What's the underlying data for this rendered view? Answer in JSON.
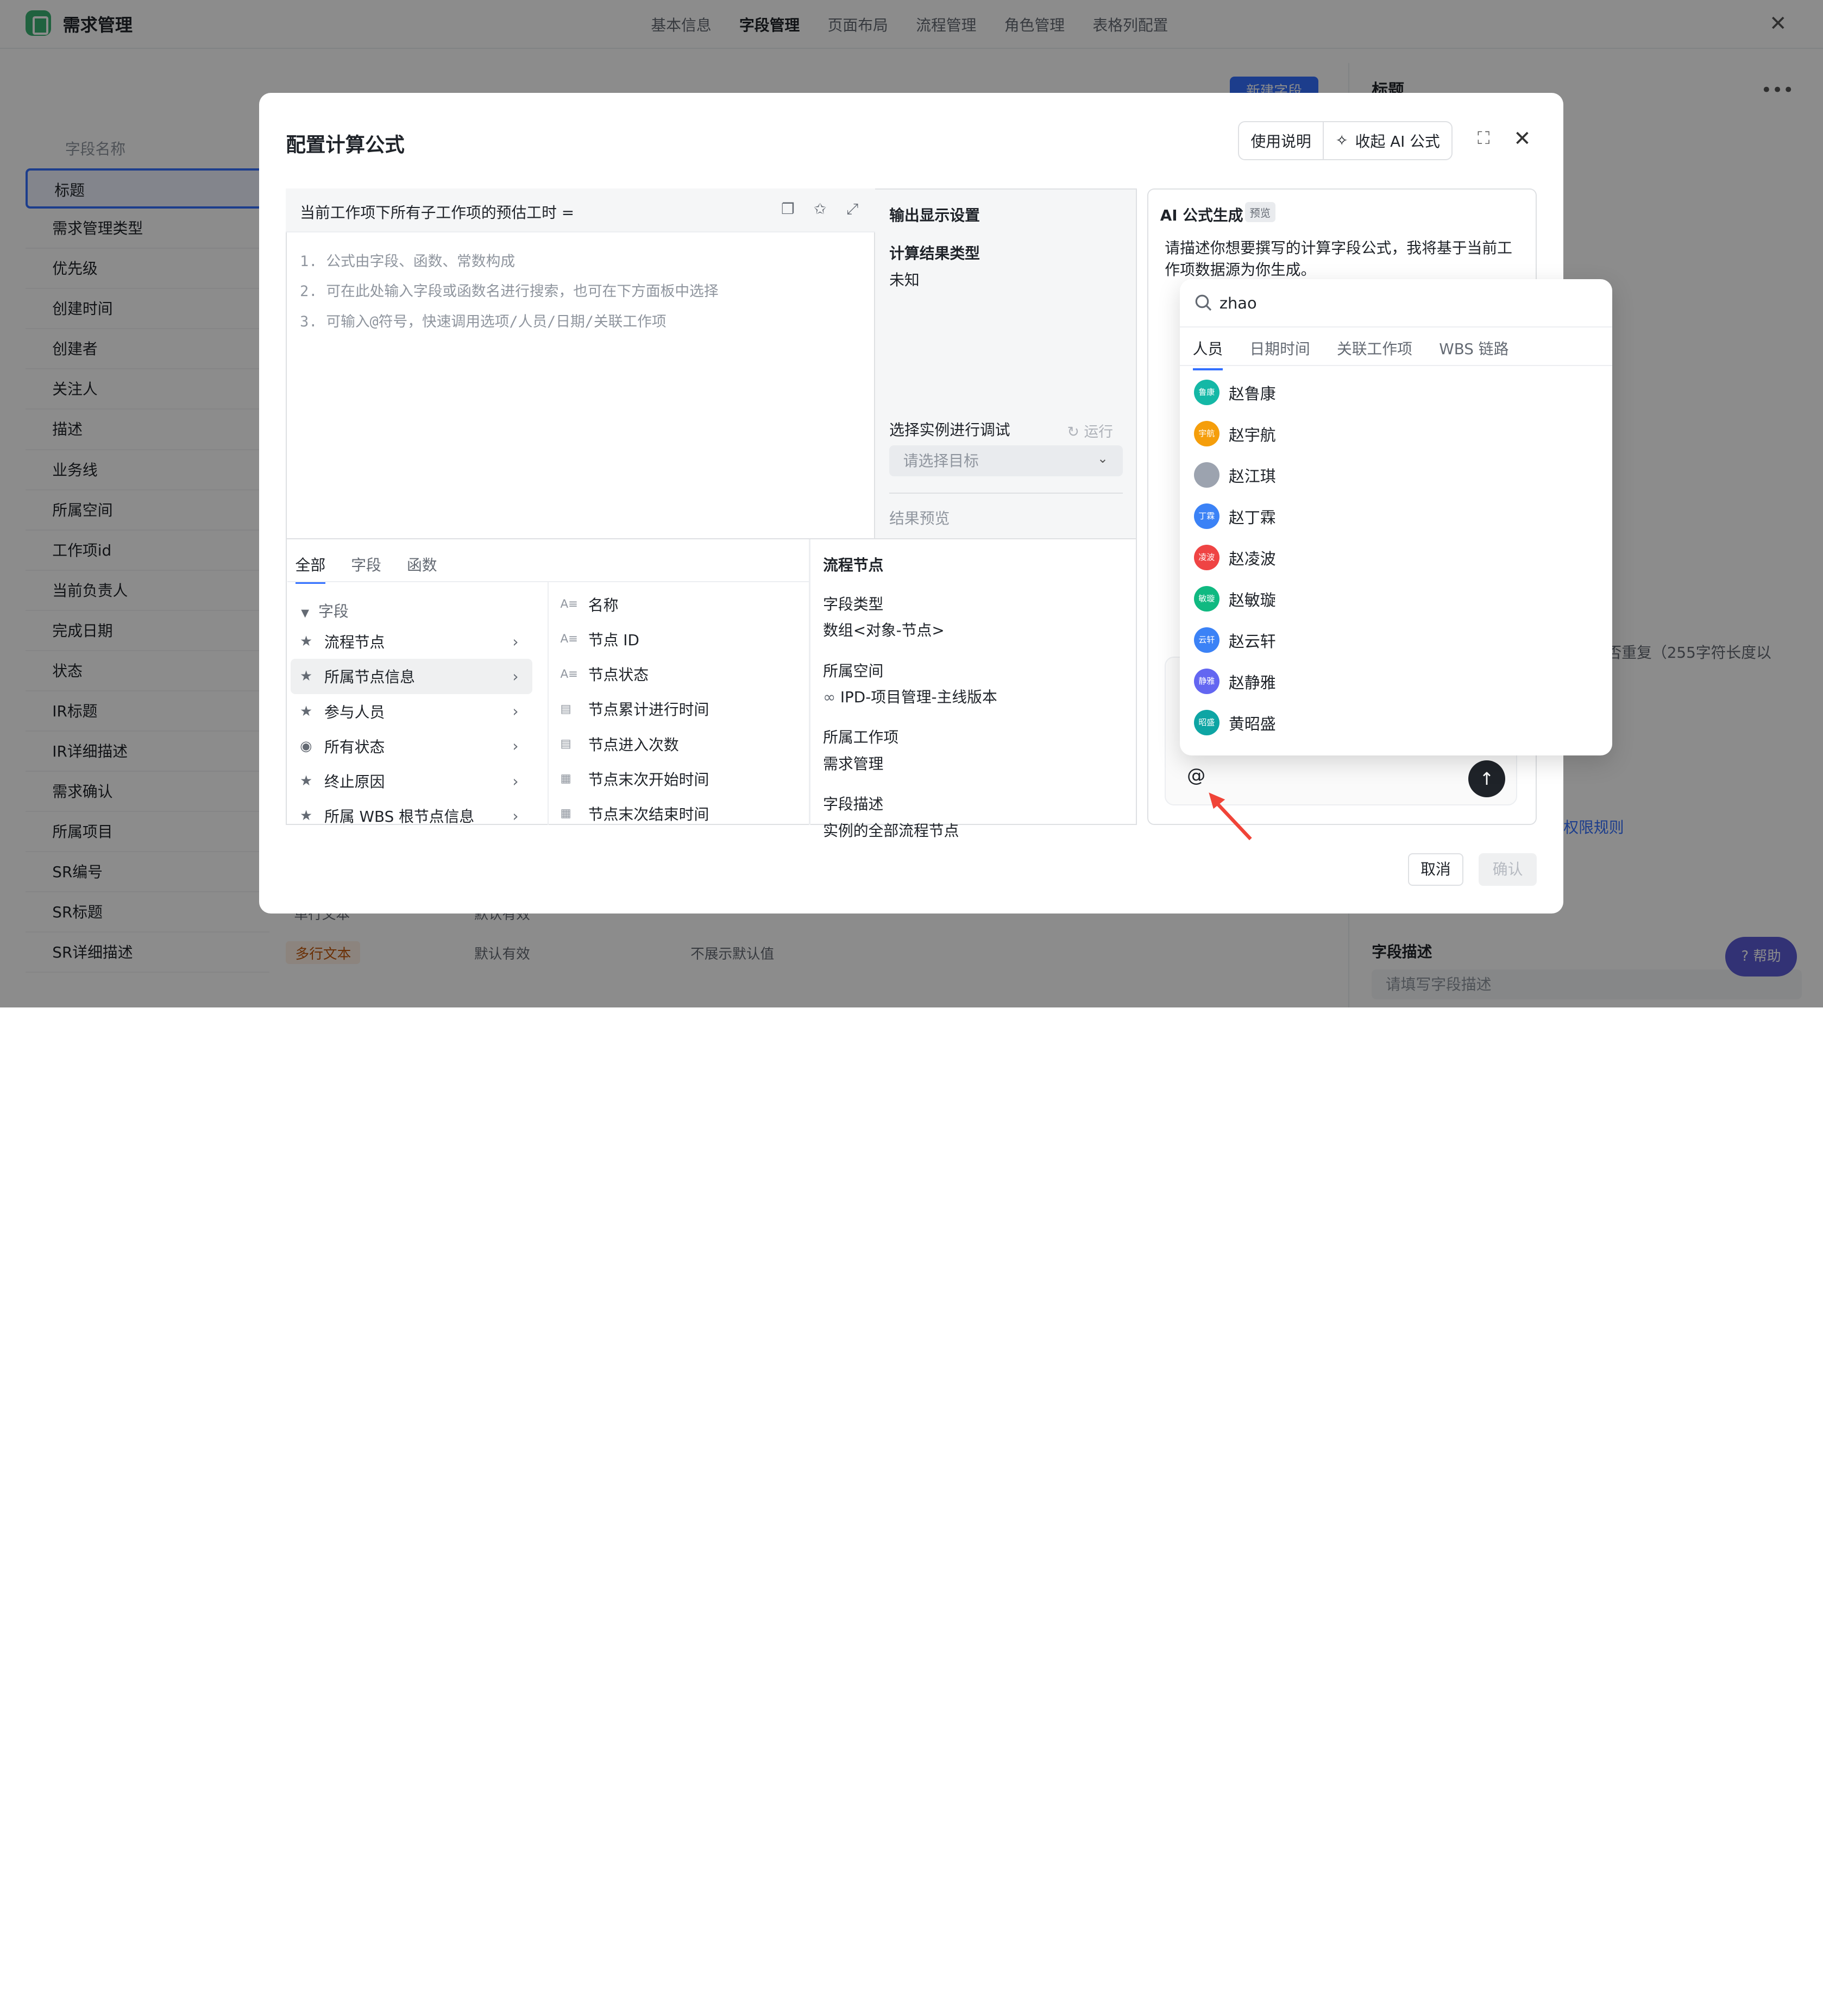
{
  "app": {
    "title": "需求管理",
    "nav": [
      "基本信息",
      "字段管理",
      "页面布局",
      "流程管理",
      "角色管理",
      "表格列配置"
    ],
    "active_nav": "字段管理",
    "close_icon": "close-icon"
  },
  "field_list": {
    "column_title": "字段名称",
    "items": [
      "标题",
      "需求管理类型",
      "优先级",
      "创建时间",
      "创建者",
      "关注人",
      "描述",
      "业务线",
      "所属空间",
      "工作项id",
      "当前负责人",
      "完成日期",
      "状态",
      "IR标题",
      "IR详细描述",
      "需求确认",
      "所属项目",
      "SR编号",
      "SR标题",
      "SR详细描述"
    ],
    "selected": "标题",
    "row_sr_title": {
      "type": "单行文本",
      "status": "默认有效"
    },
    "row_sr_desc": {
      "type": "多行文本",
      "status": "默认有效",
      "default": "不展示默认值"
    }
  },
  "background": {
    "new_field_button": "新建字段",
    "right_title": "标题",
    "right_hint": "否重复（255字符长度以",
    "right_link": "权限规则",
    "desc_label": "字段描述",
    "desc_placeholder": "请填写字段描述",
    "help_label": "帮助"
  },
  "modal": {
    "title": "配置计算公式",
    "usage_button": "使用说明",
    "collapse_ai_button": "收起 AI 公式",
    "cancel_button": "取消",
    "confirm_button": "确认",
    "editor": {
      "header": "当前工作项下所有子工作项的预估工时 =",
      "lines": [
        "1. 公式由字段、函数、常数构成",
        "2. 可在此处输入字段或函数名进行搜索，也可在下方面板中选择",
        "3. 可输入@符号，快速调用选项/人员/日期/关联工作项"
      ]
    },
    "output": {
      "title": "输出显示设置",
      "result_type_label": "计算结果类型",
      "result_type_value": "未知",
      "debug_label": "选择实例进行调试",
      "run_label": "运行",
      "target_placeholder": "请选择目标",
      "preview_label": "结果预览"
    },
    "palette": {
      "tabs": [
        "全部",
        "字段",
        "函数"
      ],
      "active_tab": "全部",
      "group_label": "字段",
      "categories": [
        "流程节点",
        "所属节点信息",
        "参与人员",
        "所有状态",
        "终止原因",
        "所属 WBS 根节点信息"
      ],
      "selected_category": "所属节点信息",
      "sub_items": [
        "名称",
        "节点 ID",
        "节点状态",
        "节点累计进行时间",
        "节点进入次数",
        "节点末次开始时间",
        "节点末次结束时间"
      ]
    },
    "detail": {
      "title": "流程节点",
      "type_label": "字段类型",
      "type_value": "数组<对象-节点>",
      "space_label": "所属空间",
      "space_value": "IPD-项目管理-主线版本",
      "item_label": "所属工作项",
      "item_value": "需求管理",
      "desc_label": "字段描述",
      "desc_value": "实例的全部流程节点"
    },
    "ai": {
      "title": "AI 公式生成",
      "badge": "预览",
      "description": "请描述你想要撰写的计算字段公式，我将基于当前工作项数据源为你生成。",
      "at_symbol": "@"
    }
  },
  "mention_popup": {
    "search_value": "zhao",
    "tabs": [
      "人员",
      "日期时间",
      "关联工作项",
      "WBS 链路"
    ],
    "active_tab": "人员",
    "people": [
      {
        "name": "赵鲁康",
        "avatar_text": "鲁康",
        "color": "#14b8a6"
      },
      {
        "name": "赵宇航",
        "avatar_text": "宇航",
        "color": "#f59e0b"
      },
      {
        "name": "赵江琪",
        "avatar_text": "",
        "color": "#9ca3af"
      },
      {
        "name": "赵丁霖",
        "avatar_text": "丁霖",
        "color": "#3b82f6"
      },
      {
        "name": "赵凌波",
        "avatar_text": "凌波",
        "color": "#ef4444"
      },
      {
        "name": "赵敏璇",
        "avatar_text": "敏璇",
        "color": "#10b981"
      },
      {
        "name": "赵云轩",
        "avatar_text": "云轩",
        "color": "#3b82f6"
      },
      {
        "name": "赵静雅",
        "avatar_text": "静雅",
        "color": "#6366f1"
      },
      {
        "name": "黄昭盛",
        "avatar_text": "昭盛",
        "color": "#0ea5a4"
      }
    ]
  }
}
